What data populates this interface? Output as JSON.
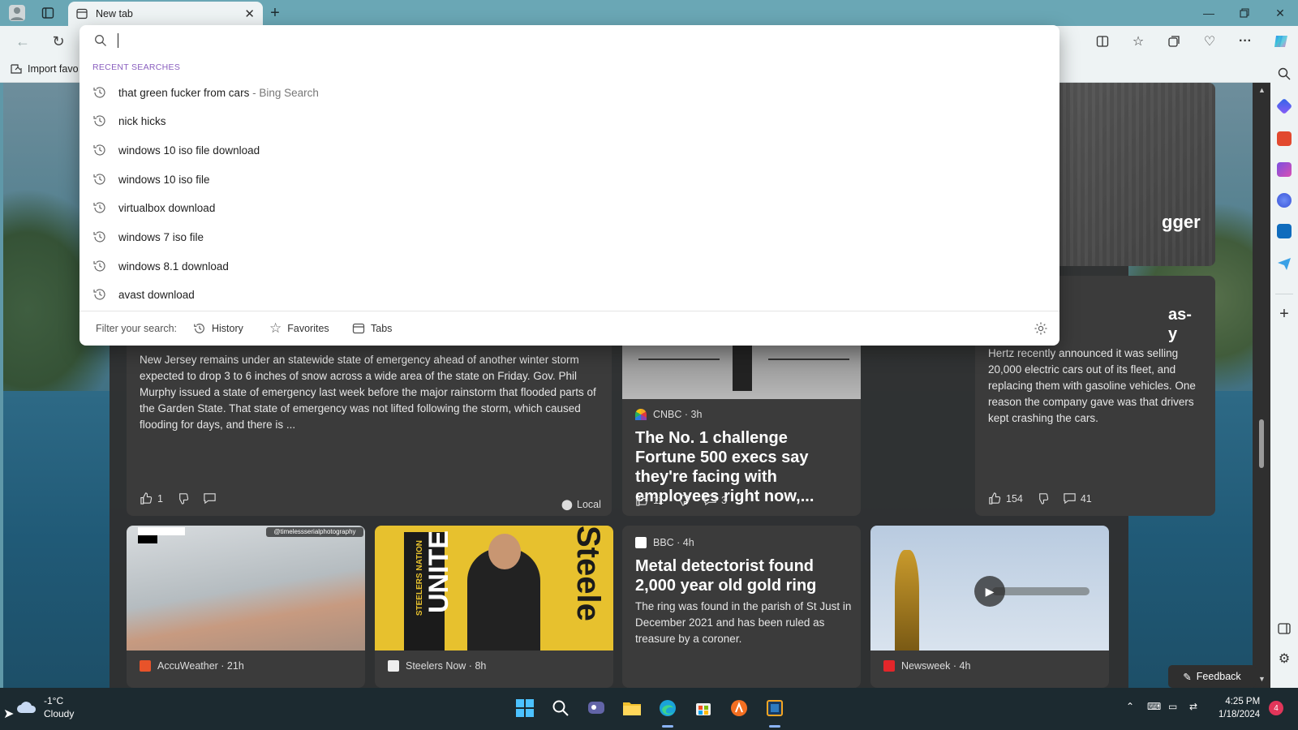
{
  "browser": {
    "tab_title": "New tab",
    "favorites_bar": {
      "import_label": "Import favo"
    }
  },
  "search_dropdown": {
    "input_value": "",
    "recent_header": "RECENT SEARCHES",
    "suggestions": [
      {
        "text": "that green fucker from cars",
        "suffix": " - Bing Search"
      },
      {
        "text": "nick hicks",
        "suffix": ""
      },
      {
        "text": "windows 10 iso file download",
        "suffix": ""
      },
      {
        "text": "windows 10 iso file",
        "suffix": ""
      },
      {
        "text": "virtualbox download",
        "suffix": ""
      },
      {
        "text": "windows 7 iso file",
        "suffix": ""
      },
      {
        "text": "windows 8.1 download",
        "suffix": ""
      },
      {
        "text": "avast download",
        "suffix": ""
      }
    ],
    "filter": {
      "label": "Filter your search:",
      "history": "History",
      "favorites": "Favorites",
      "tabs": "Tabs"
    }
  },
  "feed": {
    "top_right_fragment": "gger",
    "hertz_title_fragment": "as-",
    "hertz_title_fragment2": "y",
    "nj_card": {
      "body": "New Jersey remains under an statewide state of emergency ahead of another winter storm expected to drop 3 to 6 inches of snow across a wide area of the state on Friday. Gov. Phil Murphy issued a state of emergency last week before the major rainstorm that flooded parts of the Garden State. That state of emergency was not lifted following the storm, which caused flooding for days, and there is ...",
      "likes": "1",
      "location": "Local"
    },
    "cnbc_card": {
      "source": "CNBC · 3h",
      "headline": "The No. 1 challenge Fortune 500 execs say they're facing with employees right now,...",
      "likes": "11",
      "comments": "3"
    },
    "hertz_card": {
      "body": "Hertz recently announced it was selling 20,000 electric cars out of its fleet, and replacing them with gasoline vehicles. One reason the company gave was that drivers kept crashing the cars.",
      "likes": "154",
      "comments": "41"
    },
    "accuweather_card": {
      "source": "AccuWeather · 21h",
      "watermark": "@timelessserialphotography"
    },
    "steelers_card": {
      "source": "Steelers Now · 8h",
      "image_text": "UNITE",
      "image_text2": "Steele",
      "image_text3": "STEELERS NATION"
    },
    "bbc_card": {
      "source": "BBC · 4h",
      "headline": "Metal detectorist found 2,000 year old gold ring",
      "body": "The ring was found in the parish of St Just in December 2021 and has been ruled as treasure by a coroner."
    },
    "newsweek_card": {
      "source": "Newsweek · 4h"
    },
    "feedback_label": "Feedback"
  },
  "taskbar": {
    "weather_temp": "-1°C",
    "weather_desc": "Cloudy",
    "time": "4:25 PM",
    "date": "1/18/2024",
    "notification_count": "4"
  },
  "colors": {
    "accent_purple": "#8a5fbf",
    "taskbar_bg": "#1c2a30",
    "feed_card_bg": "#3b3b3b"
  }
}
